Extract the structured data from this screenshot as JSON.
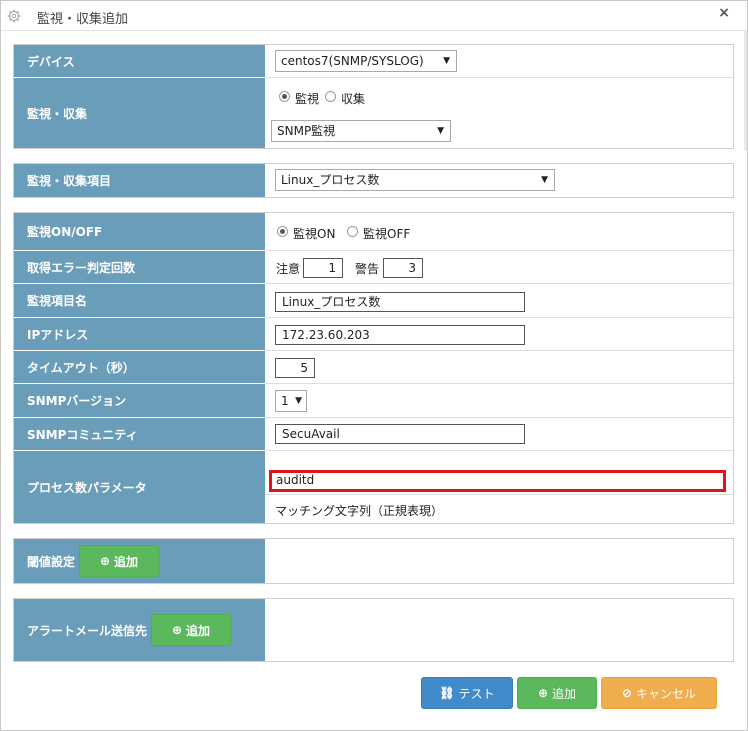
{
  "window": {
    "title": "監視・収集追加",
    "close_label": "×"
  },
  "section1": {
    "device_label": "デバイス",
    "device_value": "centos7(SNMP/SYSLOG)",
    "mode_label": "監視・収集",
    "mode_radio_monitor": "監視",
    "mode_radio_collect": "収集",
    "mode_selected": "monitor",
    "type_value": "SNMP監視"
  },
  "section2": {
    "item_label": "監視・収集項目",
    "item_value": "Linux_プロセス数"
  },
  "section3": {
    "onoff_label": "監視ON/OFF",
    "on_label": "監視ON",
    "off_label": "監視OFF",
    "onoff_selected": "on",
    "error_label": "取得エラー判定回数",
    "caution_label": "注意",
    "caution_value": "1",
    "warning_label": "警告",
    "warning_value": "3",
    "name_label": "監視項目名",
    "name_value": "Linux_プロセス数",
    "ip_label": "IPアドレス",
    "ip_value": "172.23.60.203",
    "timeout_label": "タイムアウト（秒）",
    "timeout_value": "5",
    "snmp_version_label": "SNMPバージョン",
    "snmp_version_value": "1",
    "community_label": "SNMPコミュニティ",
    "community_value": "SecuAvail",
    "process_param_label": "プロセス数パラメータ",
    "process_param_value": "auditd",
    "process_param_hint": "マッチング文字列（正規表現）"
  },
  "threshold": {
    "label": "閾値設定",
    "add_label": "追加"
  },
  "alert_mail": {
    "label": "アラートメール送信先",
    "add_label": "追加"
  },
  "footer": {
    "test_label": "テスト",
    "add_label": "追加",
    "cancel_label": "キャンセル"
  },
  "colors": {
    "label_bg": "#6a9db9",
    "highlight": "#e0141c",
    "green": "#5cb85c",
    "blue": "#428bca",
    "orange": "#f0ad4e"
  }
}
